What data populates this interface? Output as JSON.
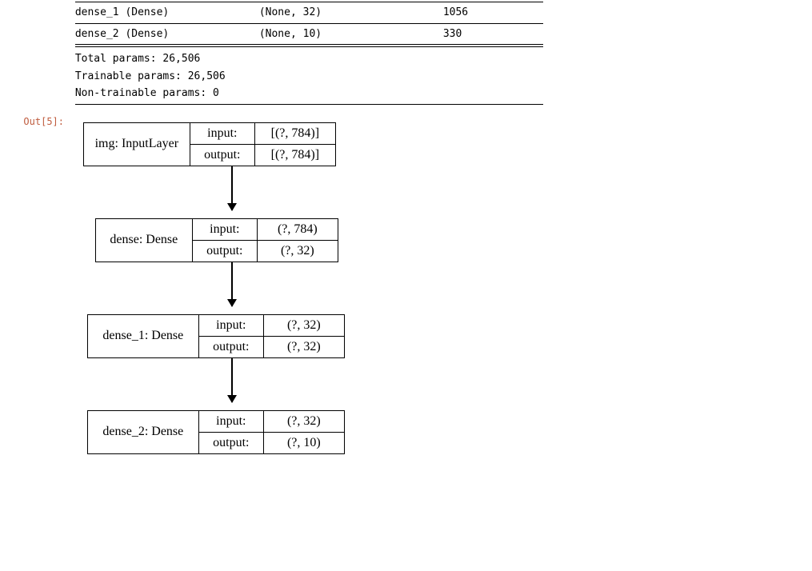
{
  "prompt": "Out[5]:",
  "summary": {
    "rows": [
      {
        "layer": "dense_1 (Dense)",
        "shape": "(None, 32)",
        "params": "1056"
      },
      {
        "layer": "dense_2 (Dense)",
        "shape": "(None, 10)",
        "params": "330"
      }
    ],
    "totals": [
      "Total params: 26,506",
      "Trainable params: 26,506",
      "Non-trainable params: 0"
    ]
  },
  "diagram": {
    "nodes": [
      {
        "name": "img: InputLayer",
        "in": "[(?, 784)]",
        "out": "[(?, 784)]"
      },
      {
        "name": "dense: Dense",
        "in": "(?, 784)",
        "out": "(?, 32)"
      },
      {
        "name": "dense_1: Dense",
        "in": "(?, 32)",
        "out": "(?, 32)"
      },
      {
        "name": "dense_2: Dense",
        "in": "(?, 32)",
        "out": "(?, 10)"
      }
    ],
    "labels": {
      "input": "input:",
      "output": "output:"
    }
  }
}
